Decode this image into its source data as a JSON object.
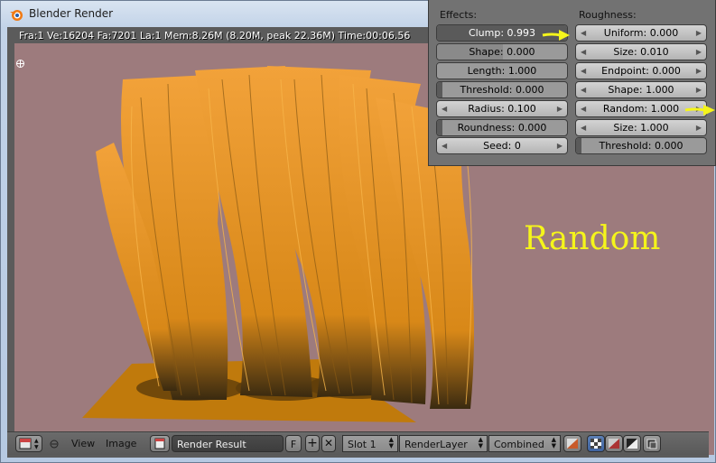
{
  "window": {
    "title": "Blender Render"
  },
  "stats": "Fra:1  Ve:16204 Fa:7201 La:1 Mem:8.26M (8.20M, peak 22.36M) Time:00:06.56",
  "annotation": "Random",
  "panel": {
    "effects_title": "Effects:",
    "roughness_title": "Roughness:",
    "effects": {
      "clump": "Clump: 0.993",
      "shape": "Shape: 0.000",
      "length": "Length: 1.000",
      "threshold": "Threshold: 0.000",
      "radius": "Radius: 0.100",
      "roundness": "Roundness: 0.000",
      "seed": "Seed: 0"
    },
    "roughness": {
      "uniform": "Uniform: 0.000",
      "size1": "Size: 0.010",
      "endpoint": "Endpoint: 0.000",
      "shape": "Shape: 1.000",
      "random": "Random: 1.000",
      "size2": "Size: 1.000",
      "threshold": "Threshold: 0.000"
    }
  },
  "bottombar": {
    "view": "View",
    "image": "Image",
    "image_name": "Render Result",
    "fake_user": "F",
    "slot": "Slot 1",
    "layer": "RenderLayer",
    "pass": "Combined"
  },
  "colors": {
    "render_background": "#9d7b7d",
    "hair": "#e8931f",
    "ground": "#c07a0c",
    "annotation": "#f5f51b"
  }
}
